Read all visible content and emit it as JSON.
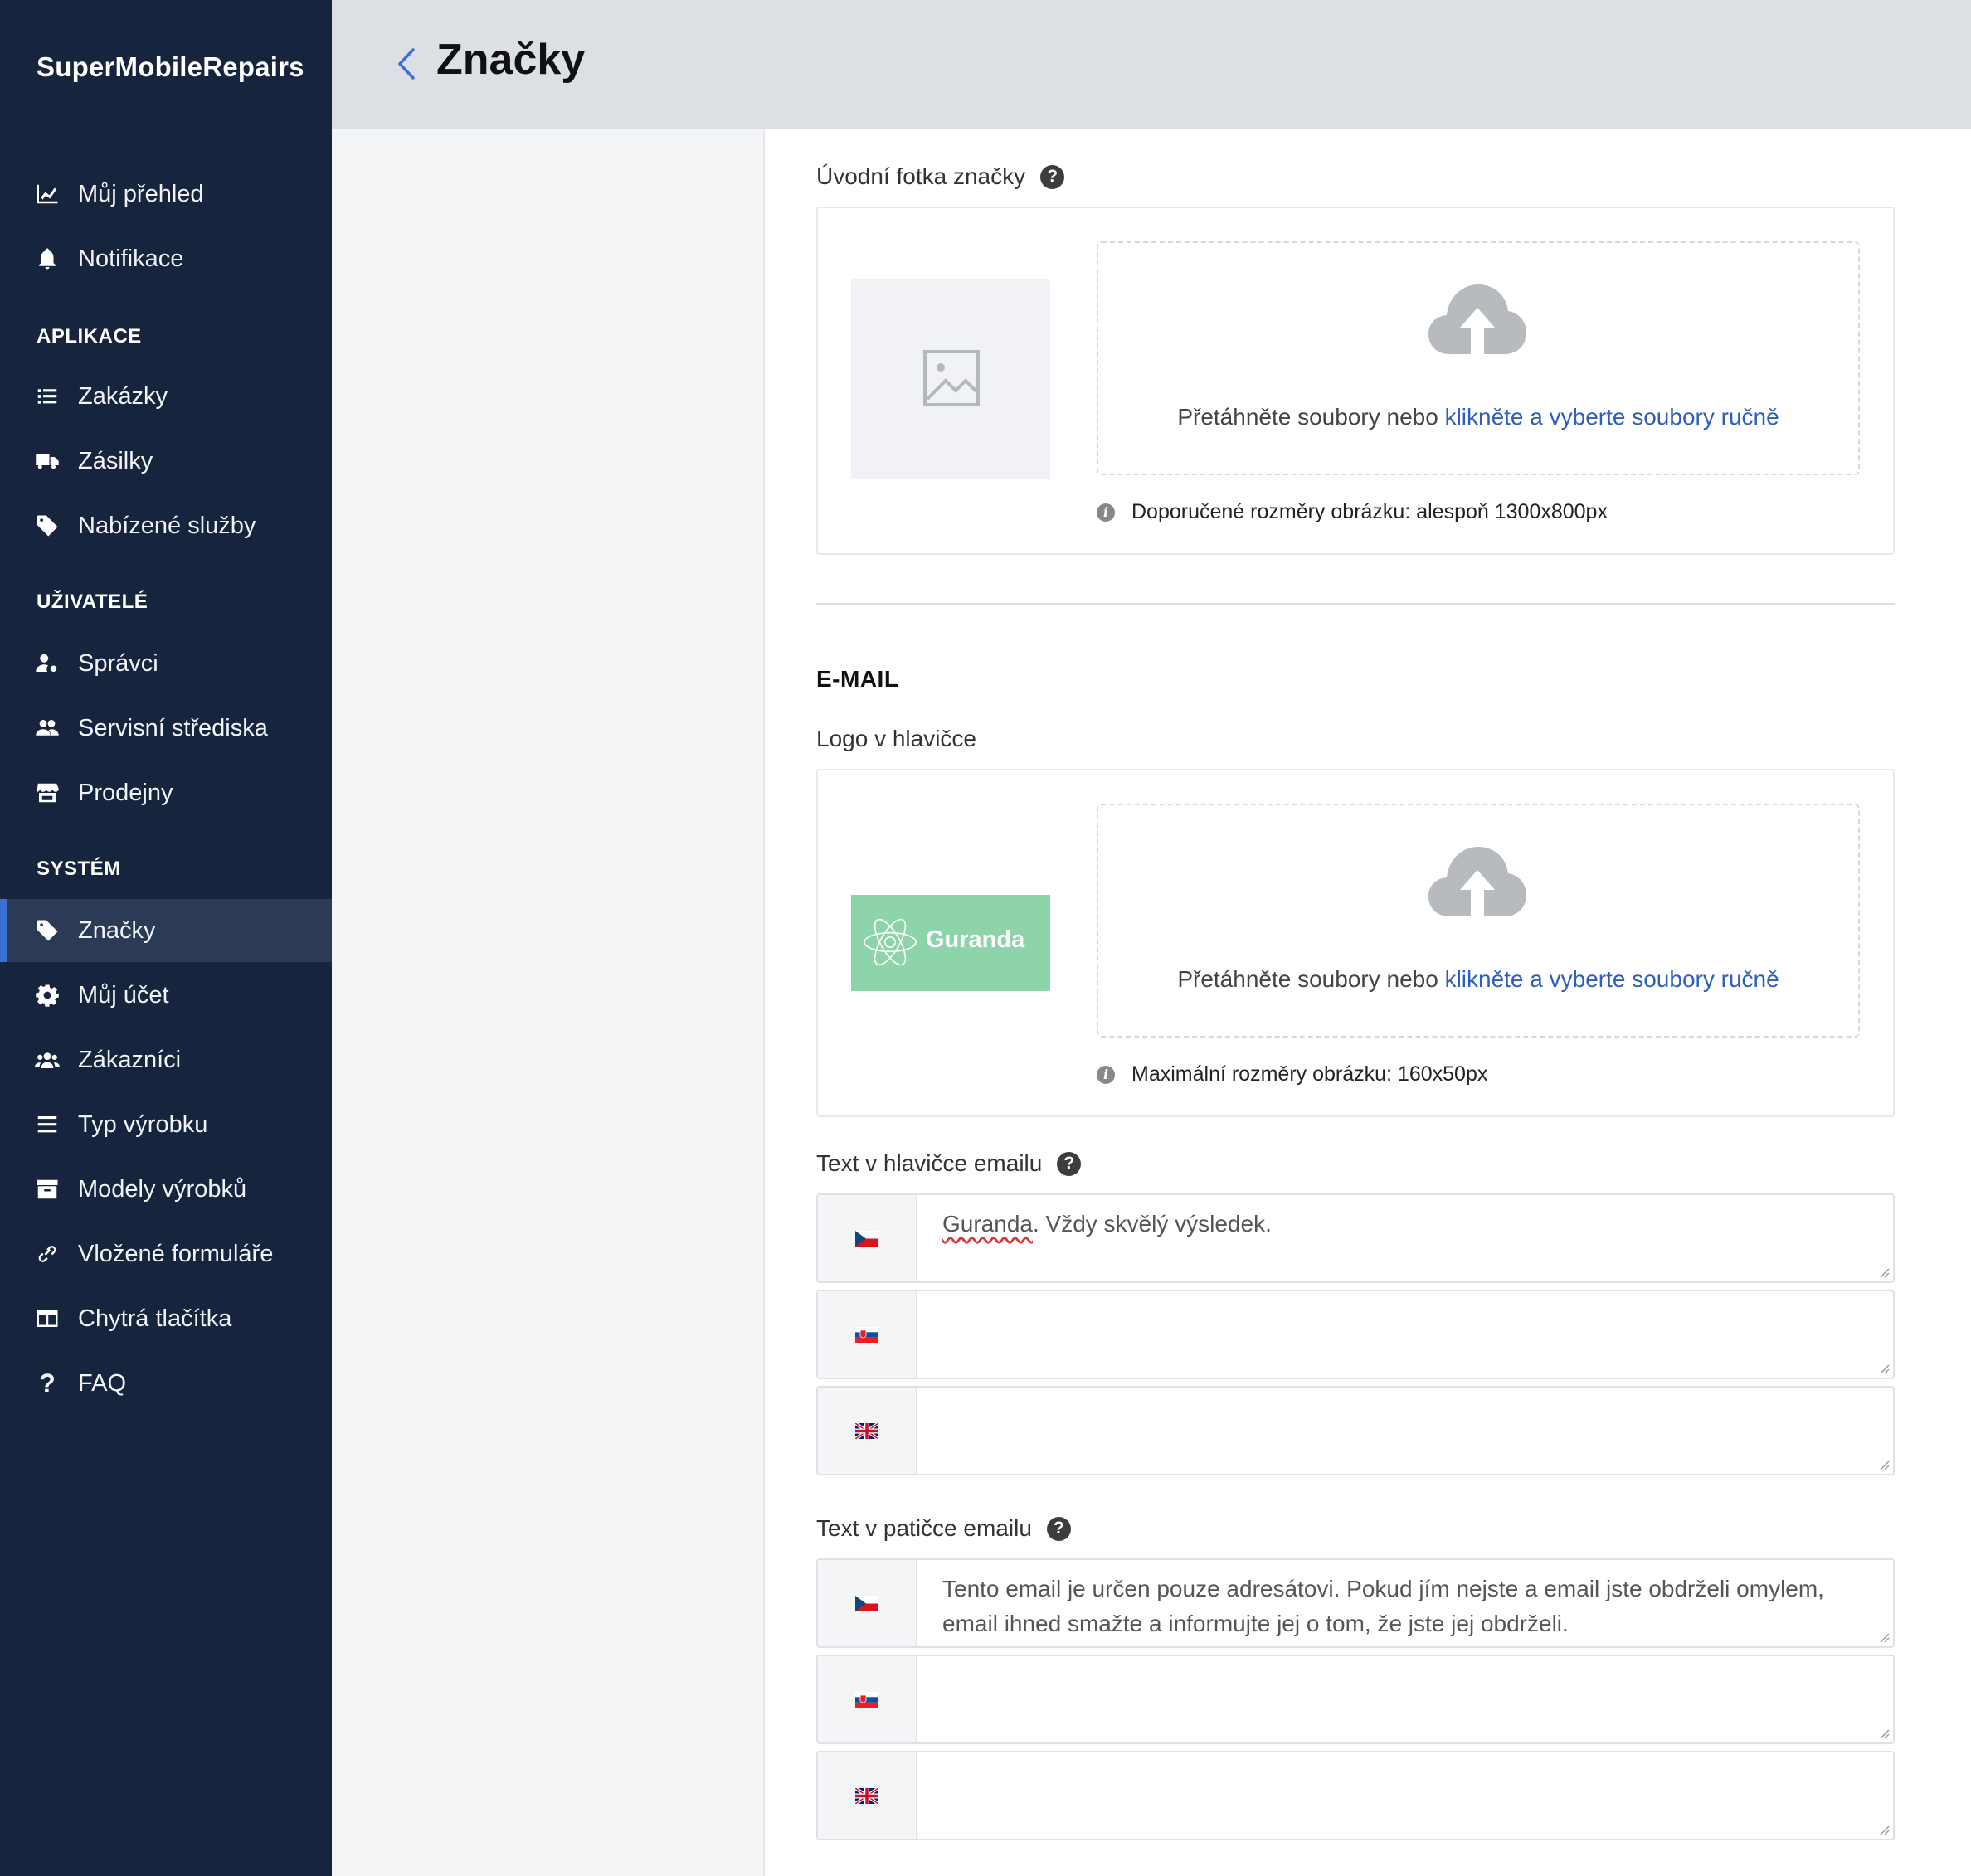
{
  "brand": "SuperMobileRepairs",
  "page_title": "Značky",
  "nav": {
    "top": [
      {
        "label": "Můj přehled",
        "icon": "chart-line-icon"
      },
      {
        "label": "Notifikace",
        "icon": "bell-icon"
      }
    ],
    "sections": [
      {
        "title": "APLIKACE",
        "items": [
          {
            "label": "Zakázky",
            "icon": "list-icon"
          },
          {
            "label": "Zásilky",
            "icon": "truck-icon"
          },
          {
            "label": "Nabízené služby",
            "icon": "tag-icon"
          }
        ]
      },
      {
        "title": "UŽIVATELÉ",
        "items": [
          {
            "label": "Správci",
            "icon": "user-cog-icon"
          },
          {
            "label": "Servisní střediska",
            "icon": "users-icon"
          },
          {
            "label": "Prodejny",
            "icon": "store-icon"
          }
        ]
      },
      {
        "title": "SYSTÉM",
        "items": [
          {
            "label": "Značky",
            "icon": "tag-icon",
            "active": true
          },
          {
            "label": "Můj účet",
            "icon": "gear-icon"
          },
          {
            "label": "Zákazníci",
            "icon": "users-group-icon"
          },
          {
            "label": "Typ výrobku",
            "icon": "bars-icon"
          },
          {
            "label": "Modely výrobků",
            "icon": "archive-icon"
          },
          {
            "label": "Vložené formuláře",
            "icon": "link-icon"
          },
          {
            "label": "Chytrá tlačítka",
            "icon": "columns-icon"
          },
          {
            "label": "FAQ",
            "icon": "question-icon"
          }
        ]
      }
    ]
  },
  "intro_photo": {
    "label": "Úvodní fotka značky",
    "drop_text": "Přetáhněte soubory nebo ",
    "drop_link": "klikněte a vyberte soubory ručně",
    "hint": "Doporučené rozměry obrázku: alespoň 1300x800px"
  },
  "email": {
    "heading": "E-MAIL",
    "logo_label": "Logo v hlavičce",
    "logo_text": "Guranda",
    "logo_bg": "#8dd4ab",
    "drop_text": "Přetáhněte soubory nebo ",
    "drop_link": "klikněte a vyberte soubory ručně",
    "logo_hint": "Maximální rozměry obrázku: 160x50px",
    "header_text_label": "Text v hlavičce emailu",
    "header_texts": {
      "cz_word": "Guranda",
      "cz_rest": ". Vždy skvělý výsledek.",
      "sk": "",
      "en": ""
    },
    "footer_text_label": "Text v patičce emailu",
    "footer_texts": {
      "cz": "Tento email je určen pouze adresátovi. Pokud jím nejste a email jste obdrželi omylem, email ihned smažte a informujte jej o tom, že jste jej obdrželi.",
      "sk": "",
      "en": ""
    }
  },
  "colors": {
    "sidebar": "#16243e",
    "active": "#2b3a55",
    "accent": "#3b6fd4",
    "link": "#2f5fb8"
  }
}
